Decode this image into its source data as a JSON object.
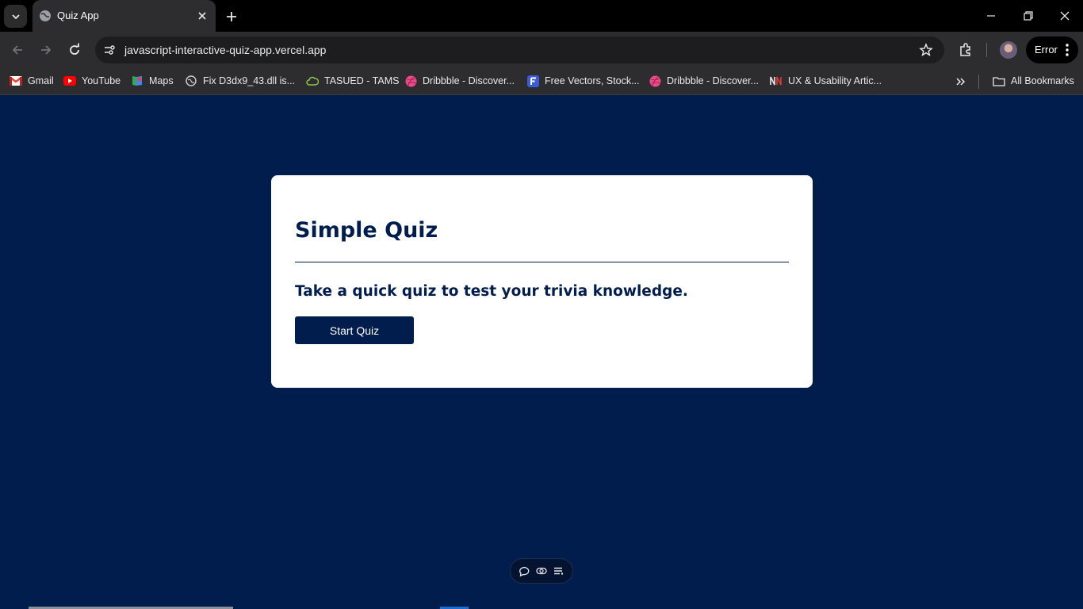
{
  "browser": {
    "tab": {
      "title": "Quiz App"
    },
    "url": "javascript-interactive-quiz-app.vercel.app",
    "profile_status": "Error",
    "bookmarks": [
      {
        "label": "Gmail",
        "icon": "gmail-icon"
      },
      {
        "label": "YouTube",
        "icon": "youtube-icon"
      },
      {
        "label": "Maps",
        "icon": "maps-icon"
      },
      {
        "label": "Fix D3dx9_43.dll is...",
        "icon": "globe-icon"
      },
      {
        "label": "TASUED - TAMS",
        "icon": "cloud-icon"
      },
      {
        "label": "Dribbble - Discover...",
        "icon": "dribbble-icon"
      },
      {
        "label": "Free Vectors, Stock...",
        "icon": "freepik-icon"
      },
      {
        "label": "Dribbble - Discover...",
        "icon": "dribbble-icon"
      },
      {
        "label": "UX & Usability Artic...",
        "icon": "nn-icon"
      }
    ],
    "all_bookmarks": "All Bookmarks"
  },
  "page": {
    "heading": "Simple Quiz",
    "tagline": "Take a quick quiz to test your trivia knowledge.",
    "start_button": "Start Quiz"
  },
  "colors": {
    "page_background": "#001d4d",
    "card_background": "#ffffff",
    "accent": "#001d4d"
  }
}
